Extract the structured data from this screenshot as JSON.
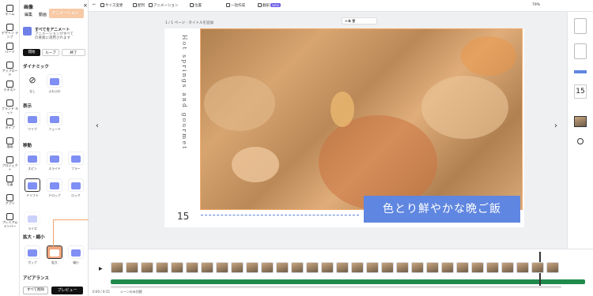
{
  "rail": {
    "items": [
      {
        "icon": "home-icon",
        "label": "ホーム"
      },
      {
        "icon": "layout-icon",
        "label": "デザイン\nテンプ"
      },
      {
        "icon": "element-icon",
        "label": "パーツ"
      },
      {
        "icon": "upload-icon",
        "label": "アップロード"
      },
      {
        "icon": "text-icon",
        "label": "テキスト"
      },
      {
        "icon": "brand-icon",
        "label": "ブランド\nキット"
      },
      {
        "icon": "type-icon",
        "label": "タイプ"
      },
      {
        "icon": "draw-icon",
        "label": "描画"
      },
      {
        "icon": "project-icon",
        "label": "プロジェクト"
      },
      {
        "icon": "photo-icon",
        "label": "写真"
      },
      {
        "icon": "apps-icon",
        "label": "アプリ"
      },
      {
        "icon": "premium-icon",
        "label": "プレミアム\nメンバー"
      }
    ]
  },
  "panel": {
    "title": "画像",
    "tabs": [
      "編集",
      "動画",
      "アニメーション"
    ],
    "all_anim_title": "すべてをアニメート",
    "all_anim_desc": "アニメーションがすべて\nの要素に適用されます",
    "segments": [
      "開始",
      "ループ",
      "終了"
    ],
    "sections": {
      "dynamic": "ダイナミック",
      "show": "表示",
      "move": "移動",
      "zoom": "拡大・縮小",
      "appearance": "アピアランス"
    },
    "dynamic_items": [
      "なし",
      "ふわふわ"
    ],
    "show_items": [
      "ワイプ",
      "フェード"
    ],
    "move_items": [
      "スピン",
      "スライド",
      "ブラー",
      "ドリフト",
      "ドロップ",
      "ロック"
    ],
    "rise_item": "ライズ",
    "zoom_items": [
      "ポップ",
      "拡大",
      "縮小"
    ],
    "click_label": "click",
    "bottom": {
      "all_delete": "すべて削除",
      "preview": "プレビュー"
    }
  },
  "topbar": {
    "items": [
      "サイズ変更",
      "配列",
      "アニメーション",
      "位置",
      "一括作成",
      "翻訳"
    ],
    "badge": "NEW",
    "zoom": "79%"
  },
  "canvas": {
    "page_label": "1 / 1 ページ - タイトルを追加",
    "vertical_text": "Hot springs and gourmet",
    "page_number": "15",
    "banner_text": "色とり鮮やかな晩ご飯"
  },
  "rightbar": {
    "page_number": "15"
  },
  "timeline": {
    "time": "0:00 / 0:15",
    "footer": "シーンのみ切替"
  },
  "colors": {
    "accent": "#5f86e0",
    "highlight": "#f0a96a",
    "preview": "#111111"
  }
}
